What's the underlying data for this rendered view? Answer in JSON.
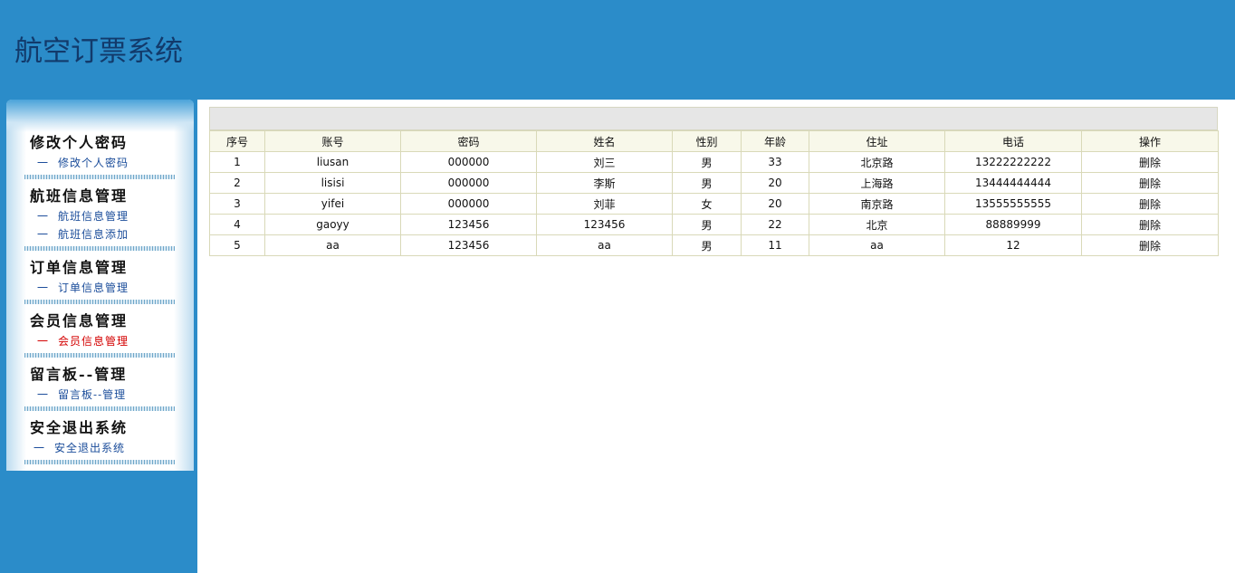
{
  "app": {
    "title": "航空订票系统"
  },
  "sidebar": {
    "groups": [
      {
        "title": "修改个人密码",
        "links": [
          {
            "label": "修改个人密码",
            "active": false
          }
        ]
      },
      {
        "title": "航班信息管理",
        "links": [
          {
            "label": "航班信息管理",
            "active": false
          },
          {
            "label": "航班信息添加",
            "active": false
          }
        ]
      },
      {
        "title": "订单信息管理",
        "links": [
          {
            "label": "订单信息管理",
            "active": false
          }
        ]
      },
      {
        "title": "会员信息管理",
        "links": [
          {
            "label": "会员信息管理",
            "active": true
          }
        ]
      },
      {
        "title": "留言板--管理",
        "links": [
          {
            "label": "留言板--管理",
            "active": false
          }
        ]
      },
      {
        "title": "安全退出系统",
        "links": [
          {
            "label": "安全退出系统",
            "active": false
          }
        ]
      }
    ],
    "dash": "一"
  },
  "table": {
    "columns": [
      "序号",
      "账号",
      "密码",
      "姓名",
      "性别",
      "年龄",
      "住址",
      "电话",
      "操作"
    ],
    "rows": [
      [
        "1",
        "liusan",
        "000000",
        "刘三",
        "男",
        "33",
        "北京路",
        "13222222222",
        "删除"
      ],
      [
        "2",
        "lisisi",
        "000000",
        "李斯",
        "男",
        "20",
        "上海路",
        "13444444444",
        "删除"
      ],
      [
        "3",
        "yifei",
        "000000",
        "刘菲",
        "女",
        "20",
        "南京路",
        "13555555555",
        "删除"
      ],
      [
        "4",
        "gaoyy",
        "123456",
        "123456",
        "男",
        "22",
        "北京",
        "88889999",
        "删除"
      ],
      [
        "5",
        "aa",
        "123456",
        "aa",
        "男",
        "11",
        "aa",
        "12",
        "删除"
      ]
    ]
  },
  "colors": {
    "header_bg": "#2b8cc9",
    "title": "#123a6b",
    "active_link": "#d40000",
    "link": "#1a4c9a"
  }
}
